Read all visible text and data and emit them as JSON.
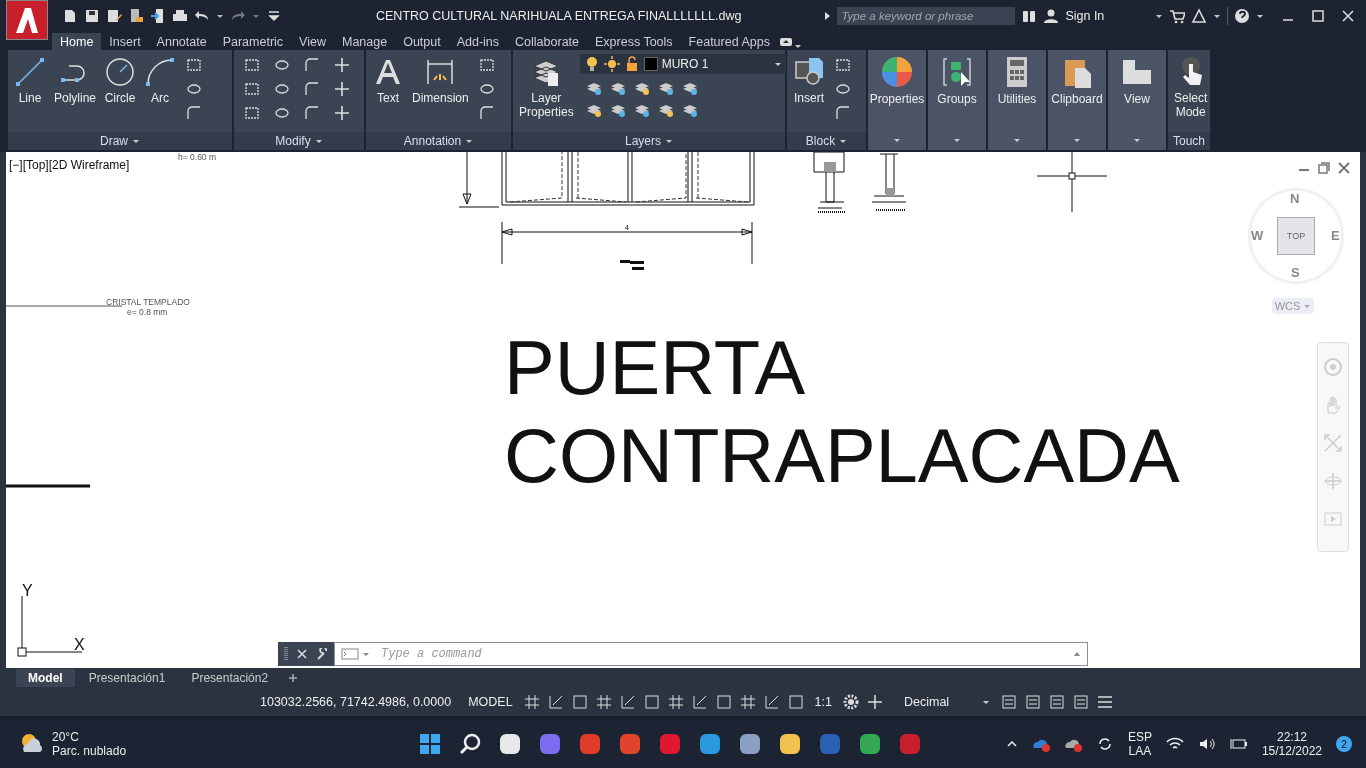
{
  "title_bar": {
    "filename": "CENTRO CULTURAL NARIHUALA ENTREGA FINALLLLLLL.dwg",
    "search_placeholder": "Type a keyword or phrase",
    "sign_in": "Sign In"
  },
  "ribbon_tabs": [
    {
      "label": "Home",
      "selected": true
    },
    {
      "label": "Insert",
      "selected": false
    },
    {
      "label": "Annotate",
      "selected": false
    },
    {
      "label": "Parametric",
      "selected": false
    },
    {
      "label": "View",
      "selected": false
    },
    {
      "label": "Manage",
      "selected": false
    },
    {
      "label": "Output",
      "selected": false
    },
    {
      "label": "Add-ins",
      "selected": false
    },
    {
      "label": "Collaborate",
      "selected": false
    },
    {
      "label": "Express Tools",
      "selected": false
    },
    {
      "label": "Featured Apps",
      "selected": false
    }
  ],
  "ribbon_panels": [
    {
      "kind": "group",
      "title": "Draw",
      "tools": [
        "Line",
        "Polyline",
        "Circle",
        "Arc"
      ]
    },
    {
      "kind": "group",
      "title": "Modify"
    },
    {
      "kind": "group",
      "title": "Annotation",
      "tools": [
        "Text",
        "Dimension"
      ]
    },
    {
      "kind": "layers",
      "title": "Layers",
      "tools": [
        "Layer Properties"
      ],
      "layer_name": "MURO 1"
    },
    {
      "kind": "group",
      "title": "Block",
      "tools": [
        "Insert"
      ]
    },
    {
      "kind": "flyout",
      "label": "Properties"
    },
    {
      "kind": "flyout",
      "label": "Groups"
    },
    {
      "kind": "flyout",
      "label": "Utilities"
    },
    {
      "kind": "flyout",
      "label": "Clipboard"
    },
    {
      "kind": "flyout",
      "label": "View"
    },
    {
      "kind": "touch",
      "title": "Touch",
      "tools": [
        "Select Mode"
      ]
    }
  ],
  "viewport": {
    "label": "[−][Top][2D Wireframe]",
    "notes": [
      "h= 0.60 m",
      "CRISTAL TEMPLADO",
      "e= 0.8 mm"
    ],
    "dimension": "4",
    "title_lines": [
      "PUERTA",
      "CONTRAPLACADA"
    ]
  },
  "viewcube": {
    "face": "TOP",
    "north": "N",
    "south": "S",
    "east": "E",
    "west": "W",
    "ucs": "WCS"
  },
  "ucs_axes": {
    "x": "X",
    "y": "Y"
  },
  "command_line": {
    "placeholder": "Type a command"
  },
  "layout_tabs": [
    {
      "label": "Model",
      "selected": true
    },
    {
      "label": "Presentación1",
      "selected": false
    },
    {
      "label": "Presentación2",
      "selected": false
    }
  ],
  "status_bar": {
    "coordinates": "103032.2566, 71742.4986, 0.0000",
    "space": "MODEL",
    "scale": "1:1",
    "units": "Decimal"
  },
  "taskbar": {
    "temperature": "20°C",
    "weather": "Parc. nublado",
    "language": "ESP",
    "layout": "LAA",
    "time": "22:12",
    "date": "15/12/2022",
    "notifications": "2"
  }
}
